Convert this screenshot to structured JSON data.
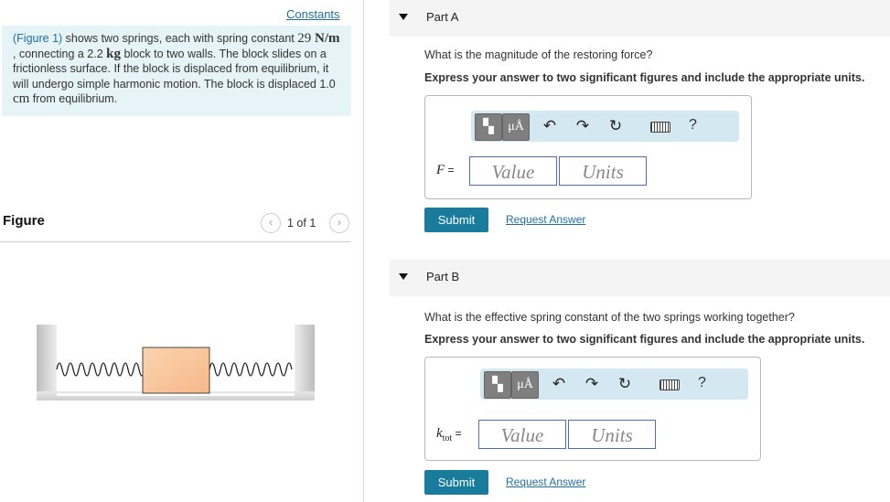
{
  "left": {
    "constants_link": "Constants",
    "problem": {
      "figure_link": "(Figure 1)",
      "t1": " shows two springs, each with spring constant ",
      "k_value": "29 ",
      "k_unit": "N/m",
      "t2": " , connecting a 2.2 ",
      "m_unit": "kg",
      "t3": " block to two walls. The block slides on a frictionless surface. If the block is displaced from equilibrium, it will undergo simple harmonic motion. The block is displaced 1.0 ",
      "d_unit": "cm",
      "t4": " from equilibrium."
    },
    "figure": {
      "title": "Figure",
      "page_count": "1 of 1",
      "prev_icon": "‹",
      "next_icon": "›"
    }
  },
  "parts": [
    {
      "title": "Part A",
      "question": "What is the magnitude of the restoring force?",
      "instruction": "Express your answer to two significant figures and include the appropriate units.",
      "var_label": "F",
      "var_suffix": " =",
      "value_placeholder": "Value",
      "units_placeholder": "Units",
      "submit": "Submit",
      "request": "Request Answer"
    },
    {
      "title": "Part B",
      "question": "What is the effective spring constant of the two springs working together?",
      "instruction": "Express your answer to two significant figures and include the appropriate units.",
      "var_label": "k",
      "var_sub": "tot",
      "var_suffix": " =",
      "value_placeholder": "Value",
      "units_placeholder": "Units",
      "submit": "Submit",
      "request": "Request Answer"
    }
  ],
  "toolbar": {
    "units_symbol": "μÅ",
    "help": "?",
    "icons": [
      "templates-icon",
      "units-icon",
      "undo-icon",
      "redo-icon",
      "reset-icon",
      "keyboard-icon",
      "help-icon"
    ]
  }
}
